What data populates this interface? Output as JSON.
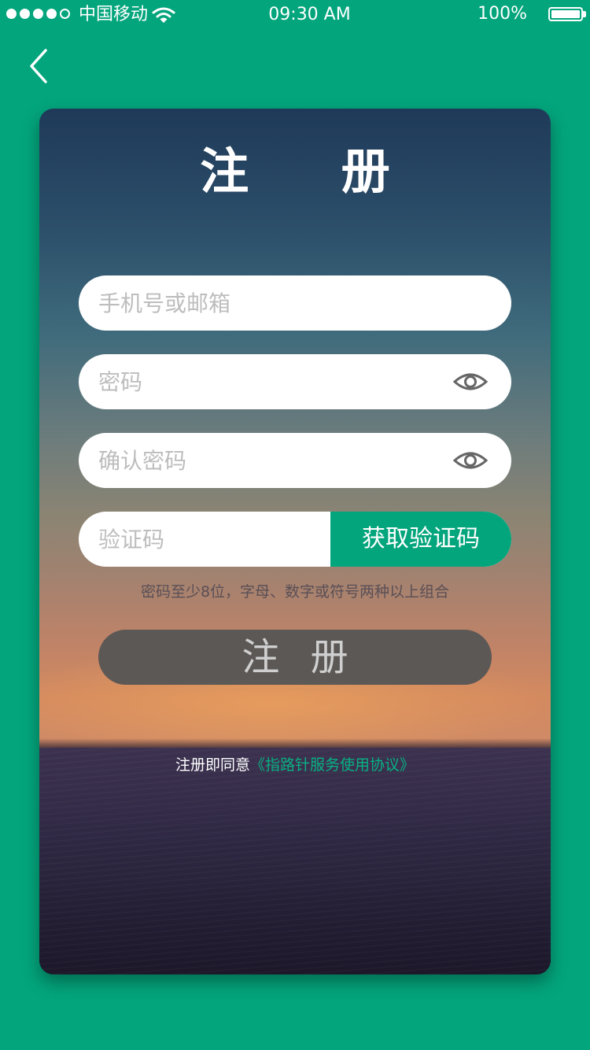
{
  "colors": {
    "brand": "#03a57c",
    "card_button_gray": "#555555",
    "link_green": "#08b183"
  },
  "status_bar": {
    "signal_dots_filled": 4,
    "signal_dots_total": 5,
    "carrier": "中国移动",
    "time": "09:30 AM",
    "battery_percent": "100%",
    "battery_level": 1.0,
    "icons": [
      "signal-dots-icon",
      "wifi-icon",
      "battery-icon"
    ]
  },
  "nav": {
    "back_icon": "chevron-left-icon"
  },
  "form": {
    "title": "注 册",
    "account": {
      "placeholder": "手机号或邮箱",
      "value": ""
    },
    "password": {
      "placeholder": "密码",
      "value": "",
      "toggle_icon": "eye-icon"
    },
    "confirm_password": {
      "placeholder": "确认密码",
      "value": "",
      "toggle_icon": "eye-icon"
    },
    "verification": {
      "placeholder": "验证码",
      "value": "",
      "button_label": "获取验证码"
    },
    "hint": "密码至少8位，字母、数字或符号两种以上组合",
    "submit_label": "注 册",
    "agreement_prefix": "注册即同意",
    "agreement_link": "《指路针服务使用协议》"
  }
}
